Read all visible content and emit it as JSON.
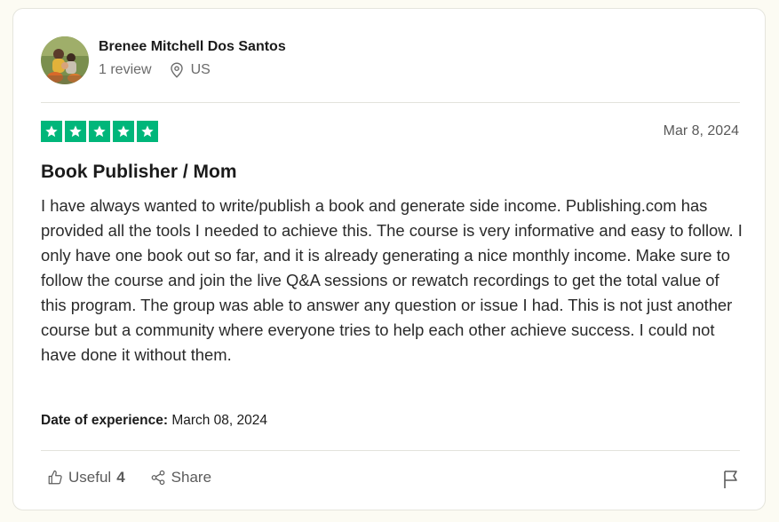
{
  "reviewer": {
    "name": "Brenee Mitchell Dos Santos",
    "review_count": "1 review",
    "country": "US"
  },
  "rating": {
    "stars": 5,
    "max": 5,
    "color": "#00b67a"
  },
  "review": {
    "date": "Mar 8, 2024",
    "title": "Book Publisher / Mom",
    "text": "I have always wanted to write/publish a book and generate side income. Publishing.com has provided all the tools I needed to achieve this. The course is very informative and easy to follow. I only have one book out so far, and it is already generating a nice monthly income. Make sure to follow the course and join the live Q&A sessions or rewatch recordings to get the total value of this program. The group was able to answer any question or issue I had. This is not just another course but a community where everyone tries to help each other achieve success. I could not have done it without them.",
    "experience_label": "Date of experience:",
    "experience_date": "March 08, 2024"
  },
  "actions": {
    "useful_label": "Useful",
    "useful_count": "4",
    "share_label": "Share",
    "icons": [
      "thumbs-up-icon",
      "share-icon",
      "flag-icon",
      "location-pin-icon",
      "star-icon"
    ]
  }
}
